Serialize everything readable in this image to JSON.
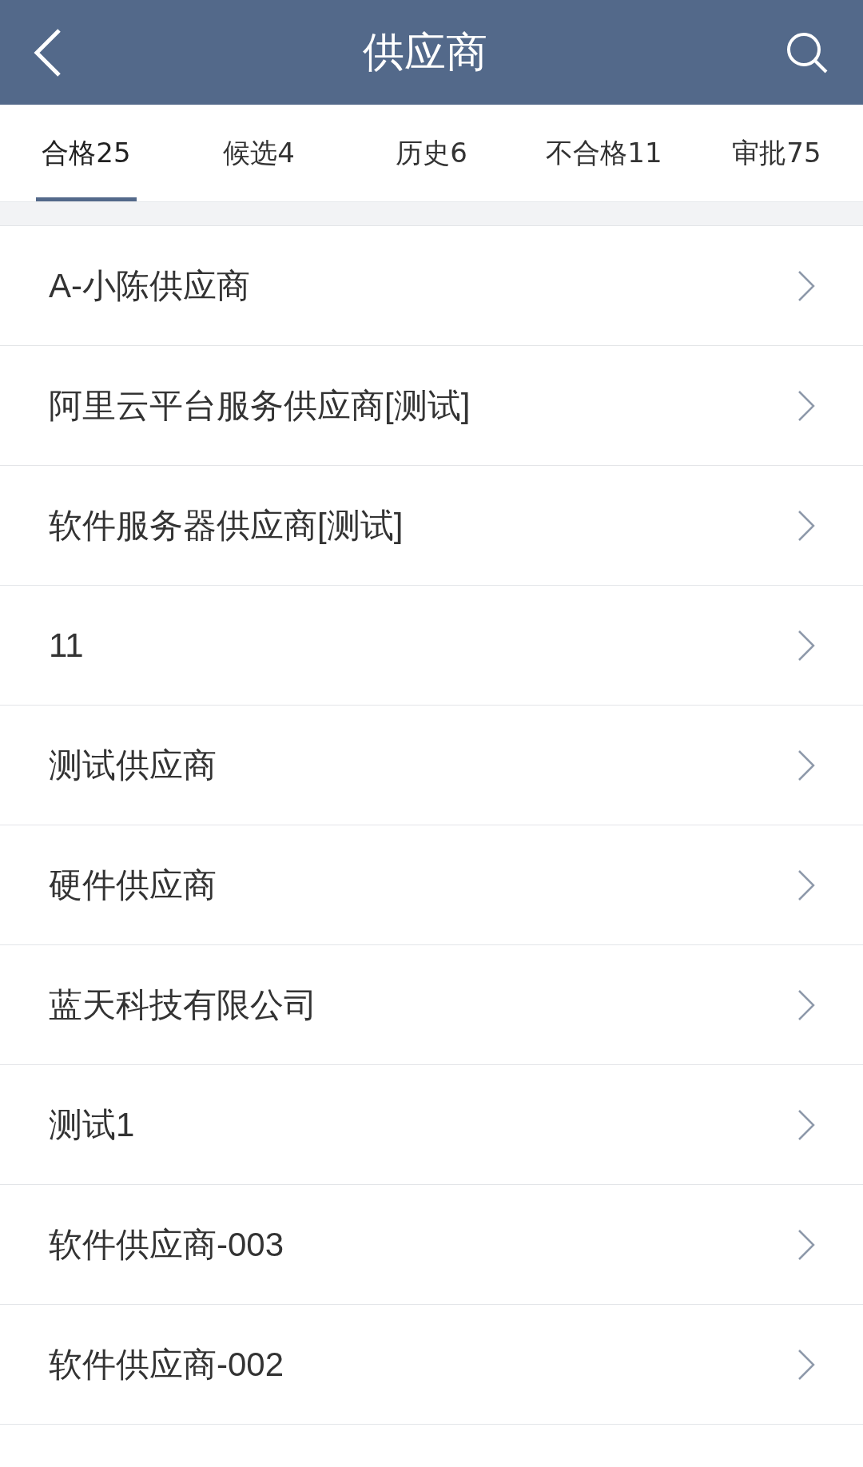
{
  "header": {
    "title": "供应商"
  },
  "tabs": [
    {
      "label": "合格25",
      "selected": true
    },
    {
      "label": "候选4",
      "selected": false
    },
    {
      "label": "历史6",
      "selected": false
    },
    {
      "label": "不合格11",
      "selected": false
    },
    {
      "label": "审批75",
      "selected": false
    }
  ],
  "suppliers": [
    {
      "name": "A-小陈供应商"
    },
    {
      "name": "阿里云平台服务供应商[测试]"
    },
    {
      "name": "软件服务器供应商[测试]"
    },
    {
      "name": "11"
    },
    {
      "name": "测试供应商"
    },
    {
      "name": "硬件供应商"
    },
    {
      "name": "蓝天科技有限公司"
    },
    {
      "name": "测试1"
    },
    {
      "name": "软件供应商-003"
    },
    {
      "name": "软件供应商-002"
    }
  ]
}
